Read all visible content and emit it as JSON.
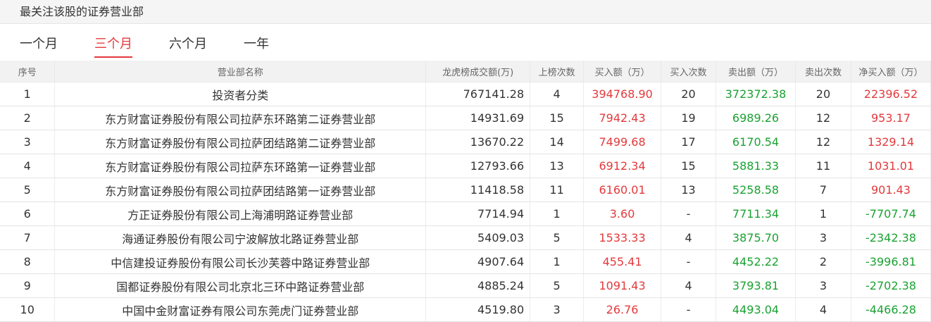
{
  "section_title": "最关注该股的证券营业部",
  "tabs": [
    {
      "label": "一个月",
      "active": false
    },
    {
      "label": "三个月",
      "active": true
    },
    {
      "label": "六个月",
      "active": false
    },
    {
      "label": "一年",
      "active": false
    }
  ],
  "colors": {
    "accent": "#e4393c",
    "buy": "#e4393c",
    "sell": "#1aa232"
  },
  "columns": [
    "序号",
    "营业部名称",
    "龙虎榜成交额(万)",
    "上榜次数",
    "买入额（万）",
    "买入次数",
    "卖出额（万）",
    "卖出次数",
    "净买入额（万）"
  ],
  "rows": [
    {
      "idx": "1",
      "name": "投资者分类",
      "turnover": "767141.28",
      "times": "4",
      "buy": "394768.90",
      "buy_count": "20",
      "sell": "372372.38",
      "sell_count": "20",
      "net": "22396.52",
      "net_sign": "pos"
    },
    {
      "idx": "2",
      "name": "东方财富证券股份有限公司拉萨东环路第二证券营业部",
      "turnover": "14931.69",
      "times": "15",
      "buy": "7942.43",
      "buy_count": "19",
      "sell": "6989.26",
      "sell_count": "12",
      "net": "953.17",
      "net_sign": "pos"
    },
    {
      "idx": "3",
      "name": "东方财富证券股份有限公司拉萨团结路第二证券营业部",
      "turnover": "13670.22",
      "times": "14",
      "buy": "7499.68",
      "buy_count": "17",
      "sell": "6170.54",
      "sell_count": "12",
      "net": "1329.14",
      "net_sign": "pos"
    },
    {
      "idx": "4",
      "name": "东方财富证券股份有限公司拉萨东环路第一证券营业部",
      "turnover": "12793.66",
      "times": "13",
      "buy": "6912.34",
      "buy_count": "15",
      "sell": "5881.33",
      "sell_count": "11",
      "net": "1031.01",
      "net_sign": "pos"
    },
    {
      "idx": "5",
      "name": "东方财富证券股份有限公司拉萨团结路第一证券营业部",
      "turnover": "11418.58",
      "times": "11",
      "buy": "6160.01",
      "buy_count": "13",
      "sell": "5258.58",
      "sell_count": "7",
      "net": "901.43",
      "net_sign": "pos"
    },
    {
      "idx": "6",
      "name": "方正证券股份有限公司上海浦明路证券营业部",
      "turnover": "7714.94",
      "times": "1",
      "buy": "3.60",
      "buy_count": "-",
      "sell": "7711.34",
      "sell_count": "1",
      "net": "-7707.74",
      "net_sign": "neg"
    },
    {
      "idx": "7",
      "name": "海通证券股份有限公司宁波解放北路证券营业部",
      "turnover": "5409.03",
      "times": "5",
      "buy": "1533.33",
      "buy_count": "4",
      "sell": "3875.70",
      "sell_count": "3",
      "net": "-2342.38",
      "net_sign": "neg"
    },
    {
      "idx": "8",
      "name": "中信建投证券股份有限公司长沙芙蓉中路证券营业部",
      "turnover": "4907.64",
      "times": "1",
      "buy": "455.41",
      "buy_count": "-",
      "sell": "4452.22",
      "sell_count": "2",
      "net": "-3996.81",
      "net_sign": "neg"
    },
    {
      "idx": "9",
      "name": "国都证券股份有限公司北京北三环中路证券营业部",
      "turnover": "4885.24",
      "times": "5",
      "buy": "1091.43",
      "buy_count": "4",
      "sell": "3793.81",
      "sell_count": "3",
      "net": "-2702.38",
      "net_sign": "neg"
    },
    {
      "idx": "10",
      "name": "中国中金财富证券有限公司东莞虎门证券营业部",
      "turnover": "4519.80",
      "times": "3",
      "buy": "26.76",
      "buy_count": "-",
      "sell": "4493.04",
      "sell_count": "4",
      "net": "-4466.28",
      "net_sign": "neg"
    }
  ]
}
